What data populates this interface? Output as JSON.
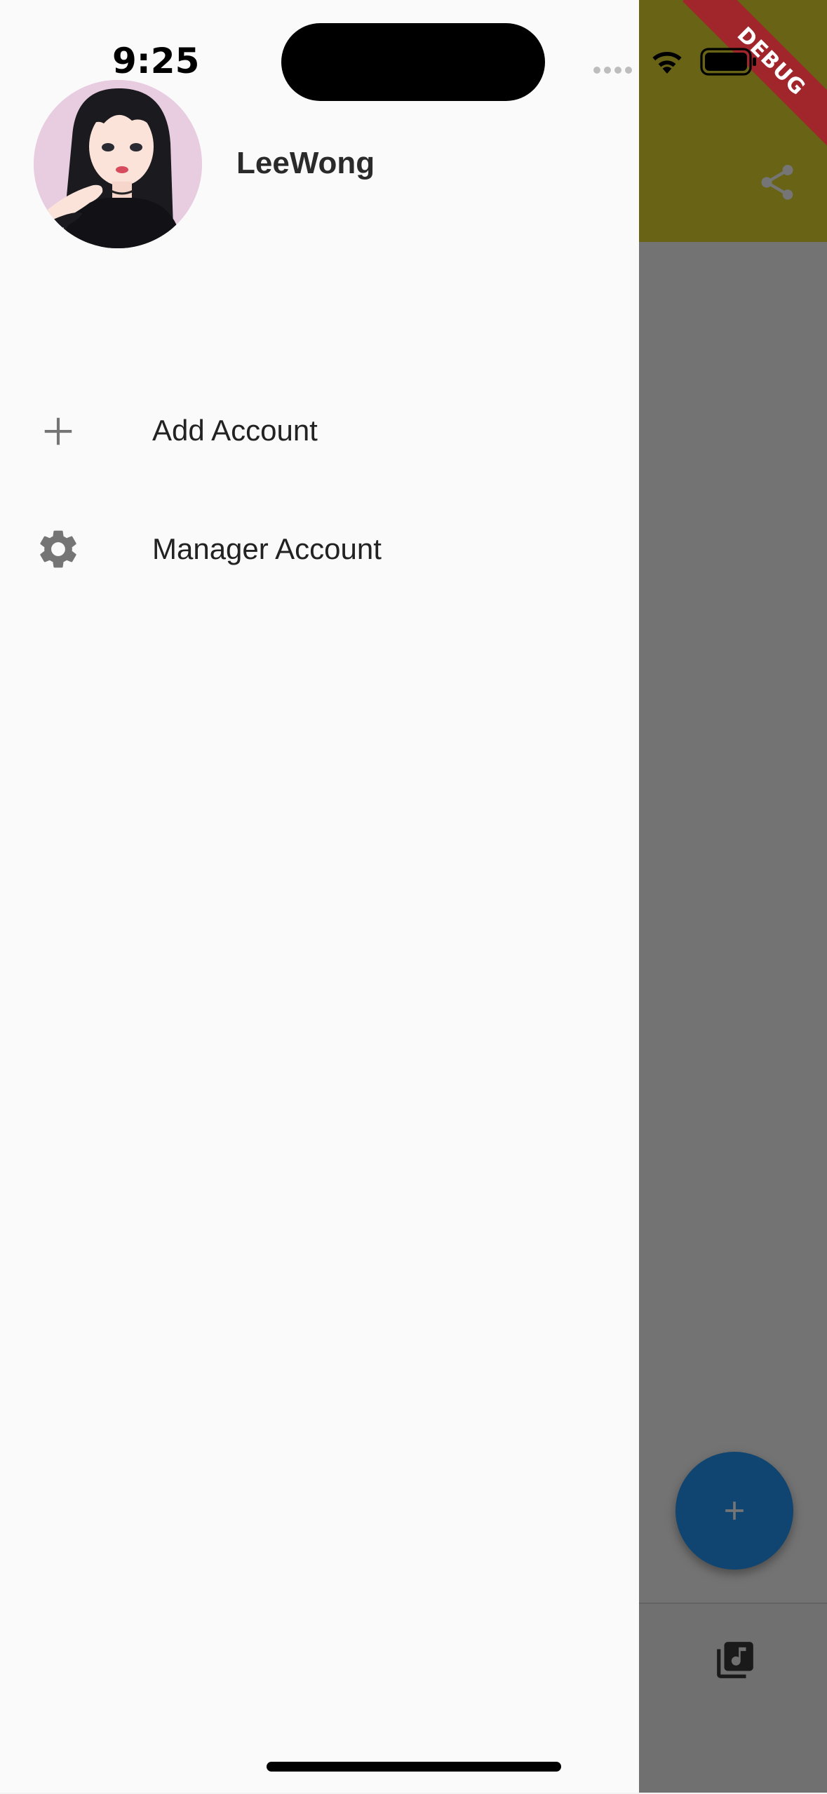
{
  "status_bar": {
    "time": "9:25"
  },
  "debug_banner": {
    "label": "DEBUG"
  },
  "drawer": {
    "header": {
      "user_name": "LeeWong"
    },
    "menu": [
      {
        "label": "Add Account",
        "icon": "plus-icon"
      },
      {
        "label": "Manager Account",
        "icon": "gear-icon"
      }
    ]
  },
  "background_app": {
    "appbar_action_icon": "share-icon",
    "fab_icon": "plus-icon",
    "bottom_nav_icon": "music-library-icon"
  },
  "colors": {
    "appbar": "#e4d730",
    "fab": "#2196f3",
    "debug_banner": "#a0262b",
    "drawer_bg": "#fafafa",
    "icon_grey": "#757575"
  }
}
